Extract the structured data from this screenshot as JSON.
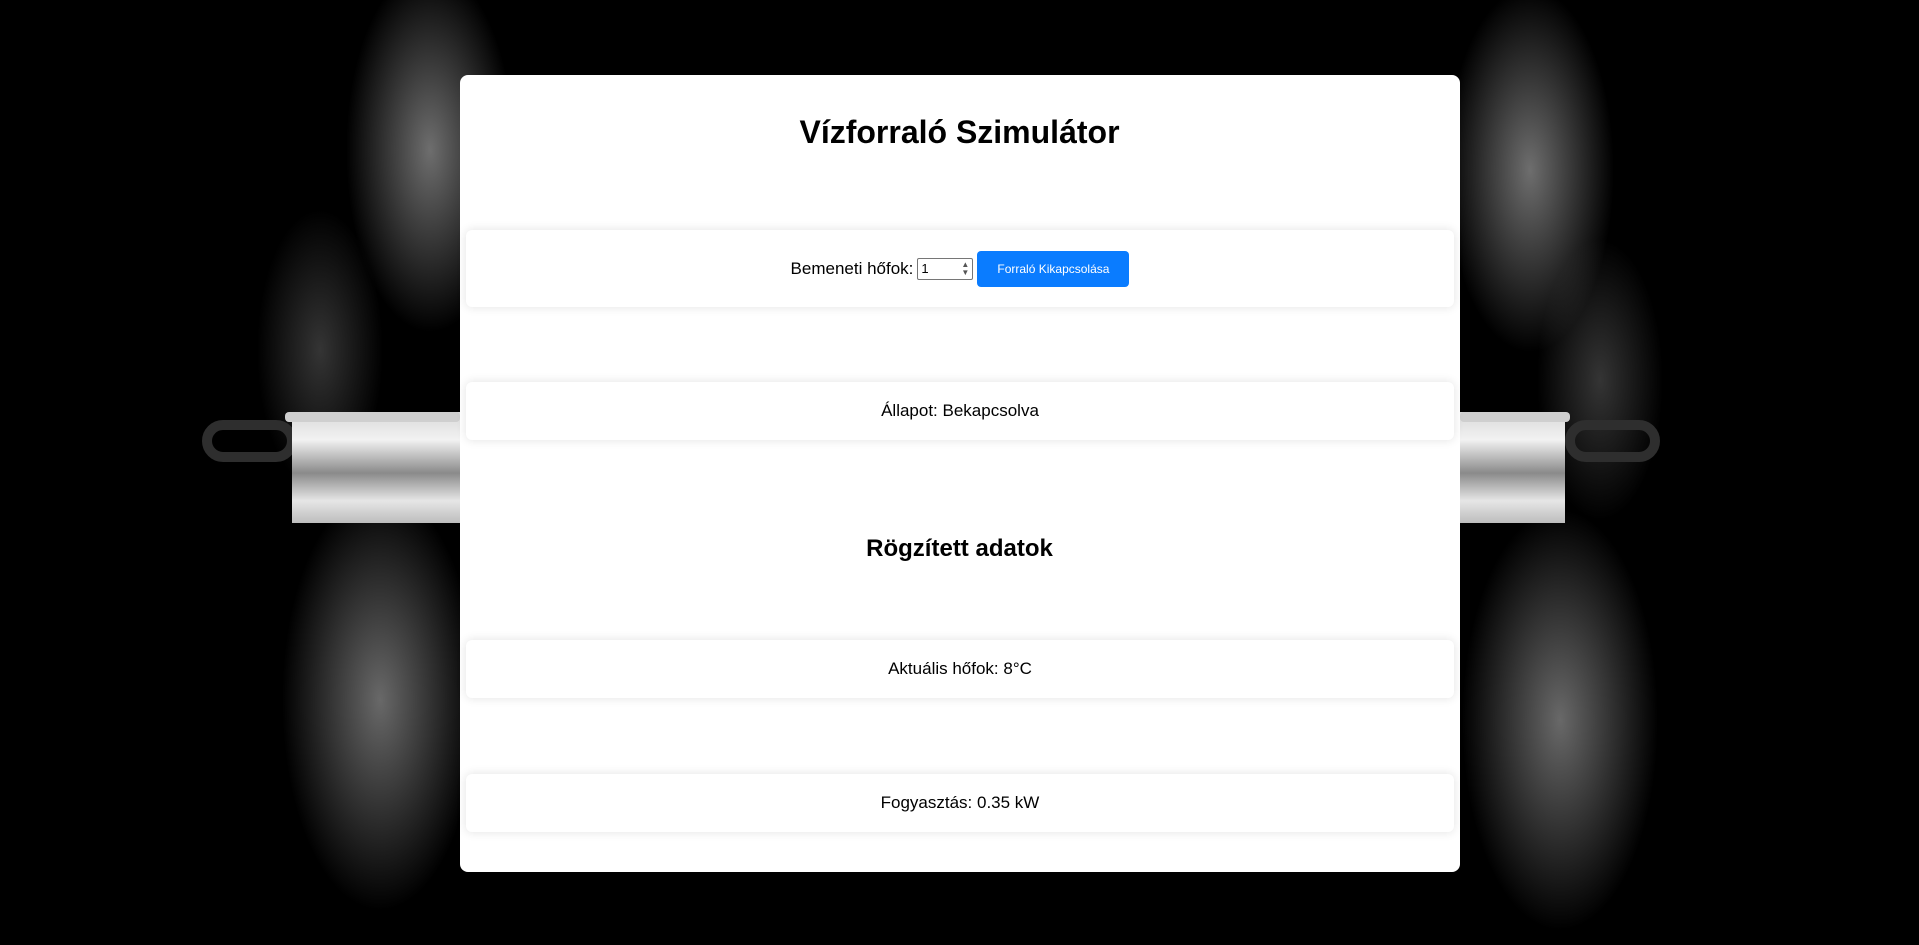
{
  "page": {
    "title": "Vízforraló Szimulátor",
    "input_label": "Bemeneti hőfok:",
    "input_value": "1",
    "toggle_button": "Forraló Kikapcsolása",
    "status_text": "Állapot: Bekapcsolva",
    "recorded_title": "Rögzített adatok",
    "current_temp": "Aktuális hőfok: 8°C",
    "consumption": "Fogyasztás: 0.35 kW"
  },
  "icons": {
    "spinner": "spinner-arrows-icon"
  },
  "colors": {
    "button": "#0a7cff",
    "background": "#000000",
    "card": "#ffffff"
  }
}
